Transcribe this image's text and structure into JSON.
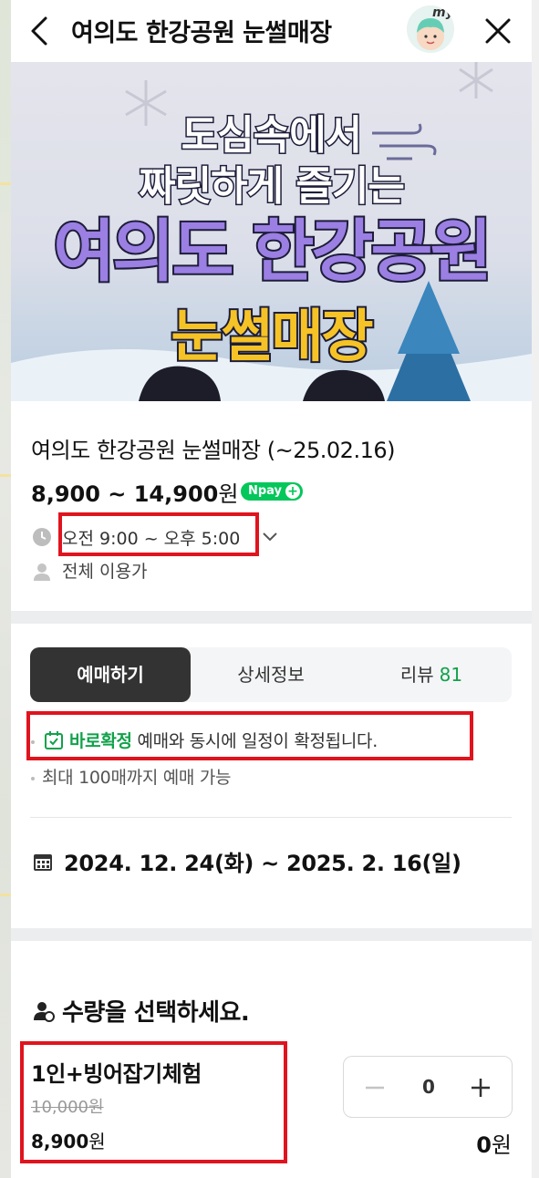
{
  "header": {
    "title": "여의도 한강공원 눈썰매장",
    "avatar_label": "my"
  },
  "banner": {
    "line1": "도심속에서",
    "line2": "짜릿하게 즐기는",
    "line3": "여의도 한강공원",
    "line4": "눈썰매장"
  },
  "product": {
    "name": "여의도 한강공원 눈썰매장 (~25.02.16)",
    "price_range": "8,900 ~ 14,900",
    "price_unit": "원",
    "npay_label": "Npay",
    "hours": "오전 9:00 ~ 오후 5:00",
    "audience": "전체 이용가"
  },
  "tabs": [
    {
      "label": "예매하기",
      "active": true
    },
    {
      "label": "상세정보",
      "active": false
    },
    {
      "label": "리뷰",
      "count": "81",
      "active": false
    }
  ],
  "booking": {
    "confirm_strong": "바로확정",
    "confirm_rest": " 예매와 동시에 일정이 확정됩니다.",
    "limit": "최대 100매까지 예매 가능",
    "date_range": "2024. 12. 24(화) ~ 2025. 2. 16(일)"
  },
  "quantity": {
    "title": "수량을 선택하세요.",
    "option_name": "1인+빙어잡기체험",
    "original_price": "10,000원",
    "price": "8,900",
    "price_unit": "원",
    "count": "0",
    "total": "0",
    "total_unit": "원"
  },
  "colors": {
    "accent_green": "#12a14b",
    "npay_green": "#03c75a",
    "highlight_red": "#e0141e",
    "active_tab": "#333333"
  }
}
